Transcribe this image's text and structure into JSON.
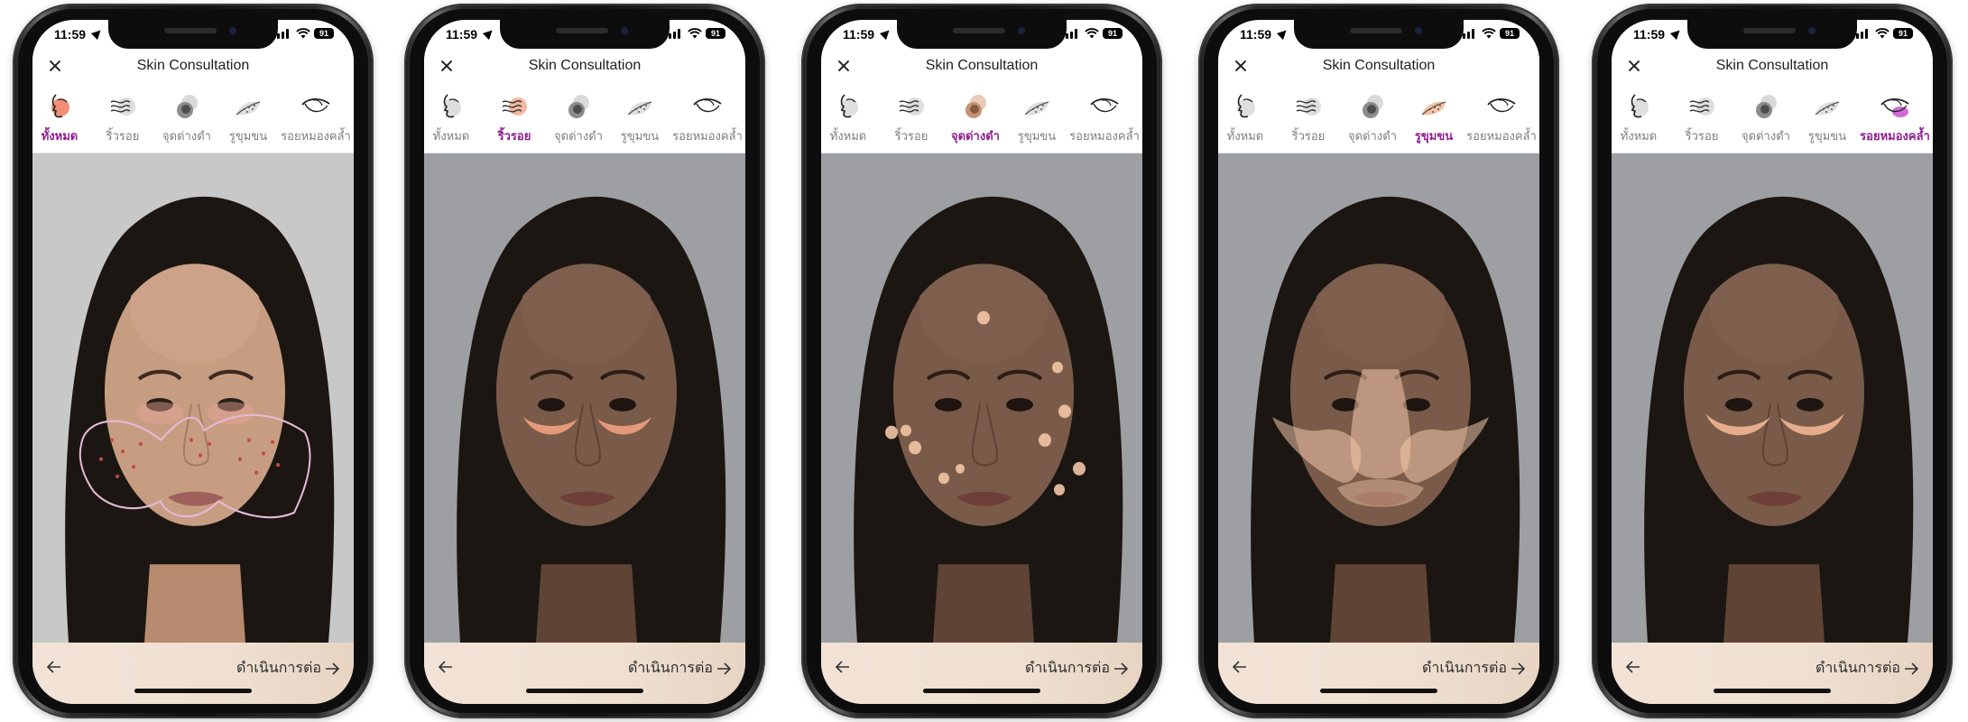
{
  "status_bar": {
    "time": "11:59",
    "battery": "91"
  },
  "header": {
    "title": "Skin Consultation"
  },
  "tabs": {
    "all": "ทั้งหมด",
    "wrinkles": "ริ้วรอย",
    "dark_spots": "จุดด่างดำ",
    "pores": "รูขุมขน",
    "dark_circles": "รอยหมองคล้ำ"
  },
  "footer": {
    "continue_label": "ดำเนินการต่อ"
  },
  "screens": [
    {
      "active_tab": "all"
    },
    {
      "active_tab": "wrinkles"
    },
    {
      "active_tab": "dark_spots"
    },
    {
      "active_tab": "pores"
    },
    {
      "active_tab": "dark_circles"
    }
  ],
  "colors": {
    "active_tab": "#8e1f8e",
    "inactive_tab": "#7d7d7d",
    "footer": "#f2e3d6"
  }
}
